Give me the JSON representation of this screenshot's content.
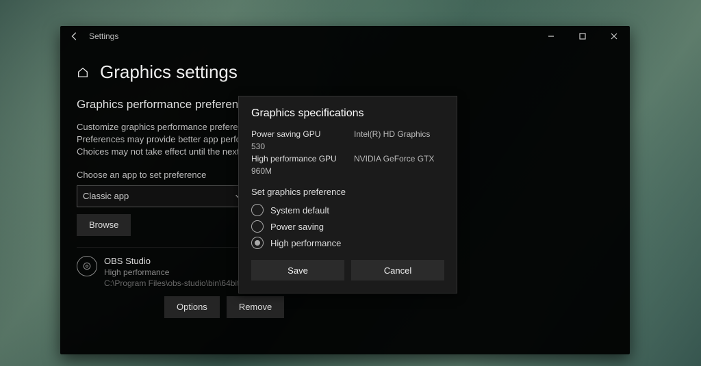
{
  "window": {
    "title": "Settings"
  },
  "page": {
    "title": "Graphics settings",
    "section": "Graphics performance preference",
    "desc1": "Customize graphics performance preference",
    "desc2": "Preferences may provide better app performance",
    "desc3": "Choices may not take effect until the next time",
    "chooseLabel": "Choose an app to set preference",
    "selectValue": "Classic app",
    "browse": "Browse"
  },
  "app": {
    "name": "OBS Studio",
    "pref": "High performance",
    "path": "C:\\Program Files\\obs-studio\\bin\\64bit\\obs64.exe",
    "options": "Options",
    "remove": "Remove"
  },
  "dialog": {
    "title": "Graphics specifications",
    "powerLabel": "Power saving GPU",
    "powerValue": "Intel(R) HD Graphics 530",
    "highLabel": "High performance GPU",
    "highValue": "NVIDIA GeForce GTX 960M",
    "setPref": "Set graphics preference",
    "opt1": "System default",
    "opt2": "Power saving",
    "opt3": "High performance",
    "save": "Save",
    "cancel": "Cancel"
  }
}
